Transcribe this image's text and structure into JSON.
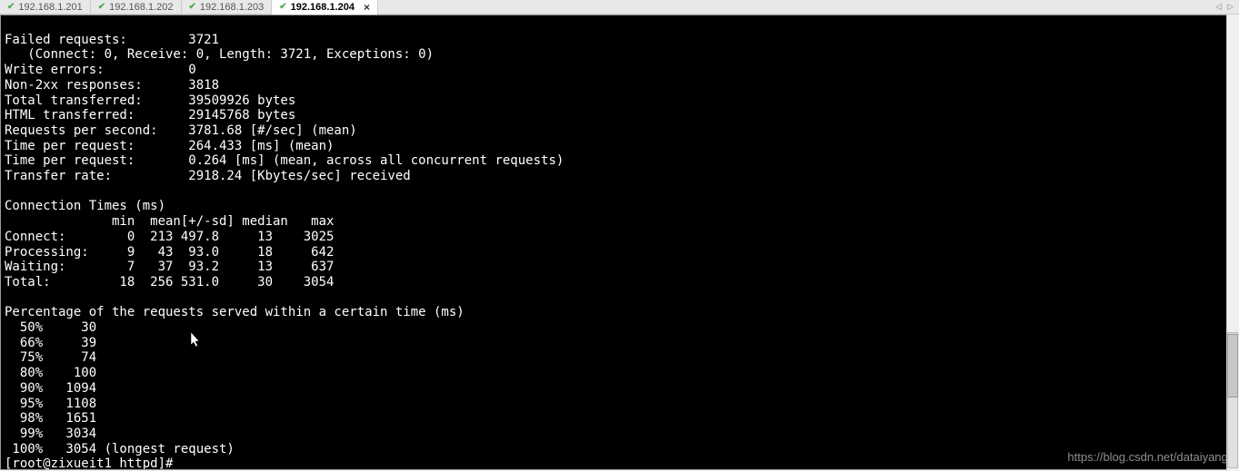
{
  "tabs": [
    {
      "label": "192.168.1.201",
      "active": false
    },
    {
      "label": "192.168.1.202",
      "active": false
    },
    {
      "label": "192.168.1.203",
      "active": false
    },
    {
      "label": "192.168.1.204",
      "active": true
    }
  ],
  "nav": {
    "prev": "◁",
    "next": "▷"
  },
  "terminal": {
    "lines": [
      "Failed requests:        3721",
      "   (Connect: 0, Receive: 0, Length: 3721, Exceptions: 0)",
      "Write errors:           0",
      "Non-2xx responses:      3818",
      "Total transferred:      39509926 bytes",
      "HTML transferred:       29145768 bytes",
      "Requests per second:    3781.68 [#/sec] (mean)",
      "Time per request:       264.433 [ms] (mean)",
      "Time per request:       0.264 [ms] (mean, across all concurrent requests)",
      "Transfer rate:          2918.24 [Kbytes/sec] received",
      "",
      "Connection Times (ms)",
      "              min  mean[+/-sd] median   max",
      "Connect:        0  213 497.8     13    3025",
      "Processing:     9   43  93.0     18     642",
      "Waiting:        7   37  93.2     13     637",
      "Total:         18  256 531.0     30    3054",
      "",
      "Percentage of the requests served within a certain time (ms)",
      "  50%     30",
      "  66%     39",
      "  75%     74",
      "  80%    100",
      "  90%   1094",
      "  95%   1108",
      "  98%   1651",
      "  99%   3034",
      " 100%   3054 (longest request)",
      "[root@zixueit1 httpd]#"
    ]
  },
  "watermark": "https://blog.csdn.net/dataiyangu"
}
